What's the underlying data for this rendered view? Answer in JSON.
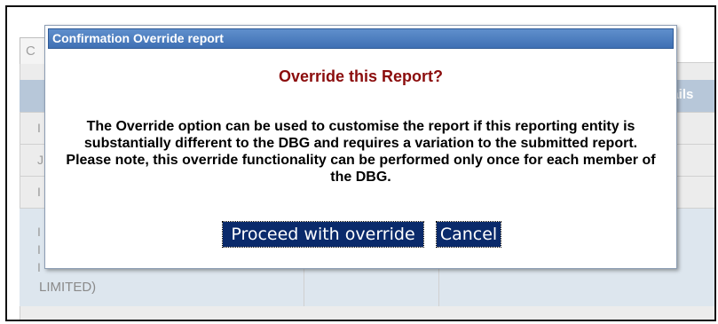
{
  "background_page": {
    "tab_label": "C",
    "header_fragment": "etails",
    "row_fragments": [
      "I",
      "J",
      "I",
      "I",
      "I",
      "I"
    ],
    "limited_text": "LIMITED)"
  },
  "dialog": {
    "title": "Confirmation Override report",
    "heading": "Override this Report?",
    "message": {
      "part1": "The Override option can be used to customise the report if this reporting entity is substantially different to the ",
      "bold1": "DBG",
      "part2": " and requires a variation to the submitted report. Please note, this override functionality can be performed only once for each member of the ",
      "bold2": "DBG",
      "part3": "."
    },
    "buttons": {
      "proceed": "Proceed with override",
      "cancel": "Cancel"
    }
  },
  "colors": {
    "title_bar": "#4a7cc0",
    "heading": "#8b0d0d",
    "button_bg": "#0a2a6b"
  }
}
